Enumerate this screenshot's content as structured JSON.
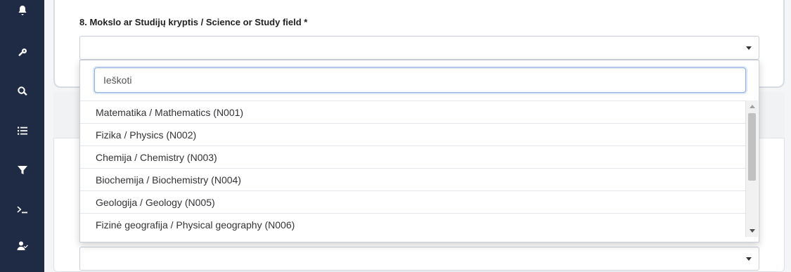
{
  "sidebar": {
    "icons": [
      "bell-icon",
      "key-icon",
      "search-icon",
      "list-icon",
      "filter-icon",
      "terminal-icon",
      "user-check-icon"
    ]
  },
  "form": {
    "field_label": "8. Mokslo ar Studijų kryptis / Science or Study field *"
  },
  "dropdown": {
    "search_placeholder": "Ieškoti",
    "options": [
      "Matematika / Mathematics (N001)",
      "Fizika / Physics (N002)",
      "Chemija / Chemistry (N003)",
      "Biochemija / Biochemistry (N004)",
      "Geologija / Geology (N005)",
      "Fizinė geografija / Physical geography (N006)"
    ]
  },
  "colors": {
    "sidebar": "#1f2a44",
    "focus_border": "#8fb0d8",
    "error": "#d43b3b"
  }
}
